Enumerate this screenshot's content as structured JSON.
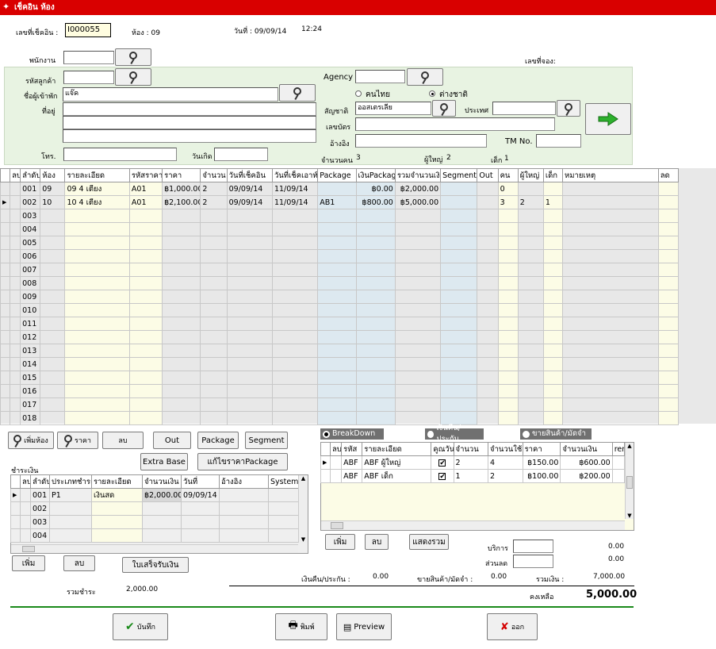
{
  "window": {
    "title": "เช็คอิน ห้อง"
  },
  "header": {
    "checkin_no_label": "เลขที่เช็คอิน :",
    "checkin_no": "I000055",
    "room_label": "ห้อง : 09",
    "date_label": "วันที่ : 09/09/14",
    "time": "12:24",
    "booking_no_label": "เลขที่จอง:"
  },
  "form": {
    "staff_label": "พนักงาน",
    "customer_code_label": "รหัสลูกค้า",
    "guest_name_label": "ชื่อผู้เข้าพัก",
    "guest_name": "แจ๊ค",
    "address_label": "ที่อยู่",
    "phone_label": "โทร.",
    "birth_label": "วันเกิด",
    "agency_label": "Agency",
    "thai_label": "คนไทย",
    "foreign_label": "ต่างชาติ",
    "selected_nationality": "foreign",
    "nationality_label": "สัญชาติ",
    "nationality": "ออสเตรเลีย",
    "country_label": "ประเทศ",
    "idcard_label": "เลขบัตร",
    "ref_label": "อ้างอิง",
    "tm_label": "TM No.",
    "people_label": "จำนวนคน",
    "people": "3",
    "adult_label": "ผู้ใหญ่",
    "adult": "2",
    "child_label": "เด็ก",
    "child": "1"
  },
  "rooms_table": {
    "columns": [
      "ลบ",
      "ลำดับ",
      "ห้อง",
      "รายละเอียด",
      "รหัสราคา",
      "ราคา",
      "จำนวน",
      "วันที่เช็คอิน",
      "วันที่เช็คเอาท์",
      "Package",
      "เงินPackage",
      "รวมจำนวนเงิน",
      "Segment",
      "Out",
      "คน",
      "ผู้ใหญ่",
      "เด็ก",
      "หมายเหตุ",
      "ลด"
    ],
    "rows": [
      [
        "",
        "001",
        "09",
        "09 4 เตียง",
        "A01",
        "฿1,000.00",
        "2",
        "09/09/14",
        "11/09/14",
        "",
        "฿0.00",
        "฿2,000.00",
        "",
        "",
        "0",
        "",
        "",
        "",
        ""
      ],
      [
        "",
        "002",
        "10",
        "10 4 เตียง",
        "A01",
        "฿2,100.00",
        "2",
        "09/09/14",
        "11/09/14",
        "AB1",
        "฿800.00",
        "฿5,000.00",
        "",
        "",
        "3",
        "2",
        "1",
        "",
        ""
      ],
      [
        "",
        "003",
        "",
        "",
        "",
        "",
        "",
        "",
        "",
        "",
        "",
        "",
        "",
        "",
        "",
        "",
        "",
        "",
        ""
      ],
      [
        "",
        "004",
        "",
        "",
        "",
        "",
        "",
        "",
        "",
        "",
        "",
        "",
        "",
        "",
        "",
        "",
        "",
        "",
        ""
      ],
      [
        "",
        "005",
        "",
        "",
        "",
        "",
        "",
        "",
        "",
        "",
        "",
        "",
        "",
        "",
        "",
        "",
        "",
        "",
        ""
      ],
      [
        "",
        "006",
        "",
        "",
        "",
        "",
        "",
        "",
        "",
        "",
        "",
        "",
        "",
        "",
        "",
        "",
        "",
        "",
        ""
      ],
      [
        "",
        "007",
        "",
        "",
        "",
        "",
        "",
        "",
        "",
        "",
        "",
        "",
        "",
        "",
        "",
        "",
        "",
        "",
        ""
      ],
      [
        "",
        "008",
        "",
        "",
        "",
        "",
        "",
        "",
        "",
        "",
        "",
        "",
        "",
        "",
        "",
        "",
        "",
        "",
        ""
      ],
      [
        "",
        "009",
        "",
        "",
        "",
        "",
        "",
        "",
        "",
        "",
        "",
        "",
        "",
        "",
        "",
        "",
        "",
        "",
        ""
      ],
      [
        "",
        "010",
        "",
        "",
        "",
        "",
        "",
        "",
        "",
        "",
        "",
        "",
        "",
        "",
        "",
        "",
        "",
        "",
        ""
      ],
      [
        "",
        "011",
        "",
        "",
        "",
        "",
        "",
        "",
        "",
        "",
        "",
        "",
        "",
        "",
        "",
        "",
        "",
        "",
        ""
      ],
      [
        "",
        "012",
        "",
        "",
        "",
        "",
        "",
        "",
        "",
        "",
        "",
        "",
        "",
        "",
        "",
        "",
        "",
        "",
        ""
      ],
      [
        "",
        "013",
        "",
        "",
        "",
        "",
        "",
        "",
        "",
        "",
        "",
        "",
        "",
        "",
        "",
        "",
        "",
        "",
        ""
      ],
      [
        "",
        "014",
        "",
        "",
        "",
        "",
        "",
        "",
        "",
        "",
        "",
        "",
        "",
        "",
        "",
        "",
        "",
        "",
        ""
      ],
      [
        "",
        "015",
        "",
        "",
        "",
        "",
        "",
        "",
        "",
        "",
        "",
        "",
        "",
        "",
        "",
        "",
        "",
        "",
        ""
      ],
      [
        "",
        "016",
        "",
        "",
        "",
        "",
        "",
        "",
        "",
        "",
        "",
        "",
        "",
        "",
        "",
        "",
        "",
        "",
        ""
      ],
      [
        "",
        "017",
        "",
        "",
        "",
        "",
        "",
        "",
        "",
        "",
        "",
        "",
        "",
        "",
        "",
        "",
        "",
        "",
        ""
      ],
      [
        "",
        "018",
        "",
        "",
        "",
        "",
        "",
        "",
        "",
        "",
        "",
        "",
        "",
        "",
        "",
        "",
        "",
        "",
        ""
      ]
    ],
    "current_row": 1
  },
  "room_buttons": {
    "add_room": "เพิ่มห้อง",
    "price": "ราคา",
    "delete": "ลบ",
    "out": "Out",
    "package": "Package",
    "segment": "Segment",
    "extra_base": "Extra Base",
    "edit_package_price": "แก้ไขราคาPackage"
  },
  "payment": {
    "section_label": "ชำระเงิน",
    "columns": [
      "ลบ",
      "ลำดับ",
      "ประเภทชำระ",
      "รายละเอียด",
      "จำนวนเงิน",
      "วันที่",
      "อ้างอิง",
      "System"
    ],
    "rows": [
      [
        "",
        "001",
        "P1",
        "เงินสด",
        "฿2,000.00",
        "09/09/14",
        "",
        ""
      ],
      [
        "",
        "002",
        "",
        "",
        "",
        "",
        "",
        ""
      ],
      [
        "",
        "003",
        "",
        "",
        "",
        "",
        "",
        ""
      ],
      [
        "",
        "004",
        "",
        "",
        "",
        "",
        "",
        ""
      ]
    ],
    "add": "เพิ่ม",
    "delete": "ลบ",
    "receipt": "ใบเสร็จรับเงิน",
    "total_label": "รวมชำระ",
    "total": "2,000.00"
  },
  "breakdown": {
    "tabs": [
      "BreakDown",
      "เงินคืน/ประกัน",
      "ขายสินค้า/มัดจำ"
    ],
    "active_tab": 0,
    "columns": [
      "ลบ",
      "รหัส",
      "รายละเอียด",
      "คูณวัน",
      "จำนวน",
      "จำนวนใช้",
      "ราคา",
      "จำนวนเงิน",
      "rem"
    ],
    "rows": [
      [
        "",
        "ABF",
        "ABF ผู้ใหญ่",
        "✔",
        "2",
        "4",
        "฿150.00",
        "฿600.00",
        ""
      ],
      [
        "",
        "ABF",
        "ABF เด็ก",
        "✔",
        "1",
        "2",
        "฿100.00",
        "฿200.00",
        ""
      ]
    ],
    "add": "เพิ่ม",
    "delete": "ลบ",
    "show_total": "แสดงรวม"
  },
  "summary": {
    "service_label": "บริการ",
    "service": "0.00",
    "discount_label": "ส่วนลด",
    "discount": "0.00",
    "refund_label": "เงินคืน/ประกัน :",
    "refund": "0.00",
    "sales_label": "ขายสินค้า/มัดจำ :",
    "sales": "0.00",
    "total_label": "รวมเงิน :",
    "total": "7,000.00",
    "balance_label": "คงเหลือ",
    "balance": "5,000.00"
  },
  "footer": {
    "save": "บันทึก",
    "print": "พิมพ์",
    "preview": "Preview",
    "exit": "ออก"
  }
}
